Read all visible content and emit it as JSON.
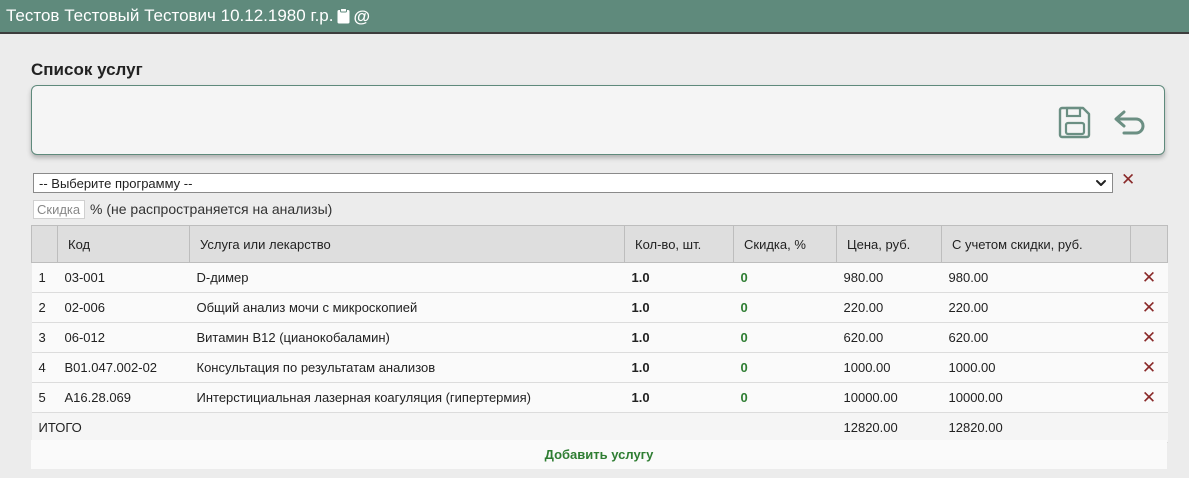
{
  "header": {
    "patient": "Тестов Тестовый Тестович 10.12.1980 г.р.",
    "at_symbol": "@"
  },
  "section_title": "Список услуг",
  "program_select": {
    "selected": "-- Выберите программу --"
  },
  "clear_program": "✕",
  "discount": {
    "placeholder": "Скидка",
    "note": "% (не распространяется на анализы)"
  },
  "table": {
    "headers": [
      "",
      "Код",
      "Услуга или лекарство",
      "Кол-во, шт.",
      "Скидка, %",
      "Цена, руб.",
      "С учетом скидки, руб.",
      ""
    ],
    "rows": [
      {
        "n": "1",
        "code": "03-001",
        "service": "D-димер",
        "qty": "1.0",
        "discount": "0",
        "price": "980.00",
        "total": "980.00"
      },
      {
        "n": "2",
        "code": "02-006",
        "service": "Общий анализ мочи с микроскопией",
        "qty": "1.0",
        "discount": "0",
        "price": "220.00",
        "total": "220.00"
      },
      {
        "n": "3",
        "code": "06-012",
        "service": "Витамин В12 (цианокобаламин)",
        "qty": "1.0",
        "discount": "0",
        "price": "620.00",
        "total": "620.00"
      },
      {
        "n": "4",
        "code": "B01.047.002-02",
        "service": "Консультация по результатам анализов",
        "qty": "1.0",
        "discount": "0",
        "price": "1000.00",
        "total": "1000.00"
      },
      {
        "n": "5",
        "code": "A16.28.069",
        "service": "Интерстициальная лазерная коагуляция (гипертермия)",
        "qty": "1.0",
        "discount": "0",
        "price": "10000.00",
        "total": "10000.00"
      }
    ],
    "delete_symbol": "✕",
    "totals": {
      "label": "ИТОГО",
      "price": "12820.00",
      "total": "12820.00"
    }
  },
  "add_service": "Добавить услугу",
  "colors": {
    "topbar": "#5f8a7c",
    "accent_green": "#2e7d32",
    "delete_red": "#8a2a2a"
  },
  "icons": [
    "clipboard-icon",
    "save-icon",
    "undo-icon",
    "chevron-down-icon",
    "close-icon"
  ]
}
